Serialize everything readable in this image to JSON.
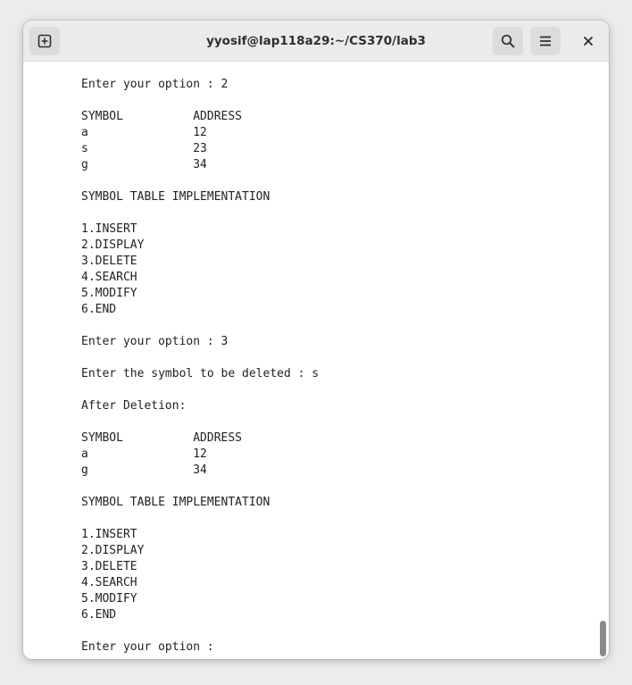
{
  "window": {
    "title": "yyosif@lap118a29:~/CS370/lab3"
  },
  "headerbar": {
    "new_tab_icon": "new-tab-icon",
    "search_icon": "search-icon",
    "menu_icon": "hamburger-menu-icon",
    "close_icon": "close-icon"
  },
  "colors": {
    "headerbar_bg": "#ebebeb",
    "button_bg": "#dcdcdc",
    "terminal_bg": "#ffffff",
    "terminal_fg": "#222222"
  },
  "terminal": {
    "lines": [
      "Enter your option : 2",
      "",
      "SYMBOL          ADDRESS",
      "a               12",
      "s               23",
      "g               34",
      "",
      "SYMBOL TABLE IMPLEMENTATION",
      "",
      "1.INSERT",
      "2.DISPLAY",
      "3.DELETE",
      "4.SEARCH",
      "5.MODIFY",
      "6.END",
      "",
      "Enter your option : 3",
      "",
      "Enter the symbol to be deleted : s",
      "",
      "After Deletion:",
      "",
      "SYMBOL          ADDRESS",
      "a               12",
      "g               34",
      "",
      "SYMBOL TABLE IMPLEMENTATION",
      "",
      "1.INSERT",
      "2.DISPLAY",
      "3.DELETE",
      "4.SEARCH",
      "5.MODIFY",
      "6.END",
      "",
      "Enter your option : "
    ]
  }
}
